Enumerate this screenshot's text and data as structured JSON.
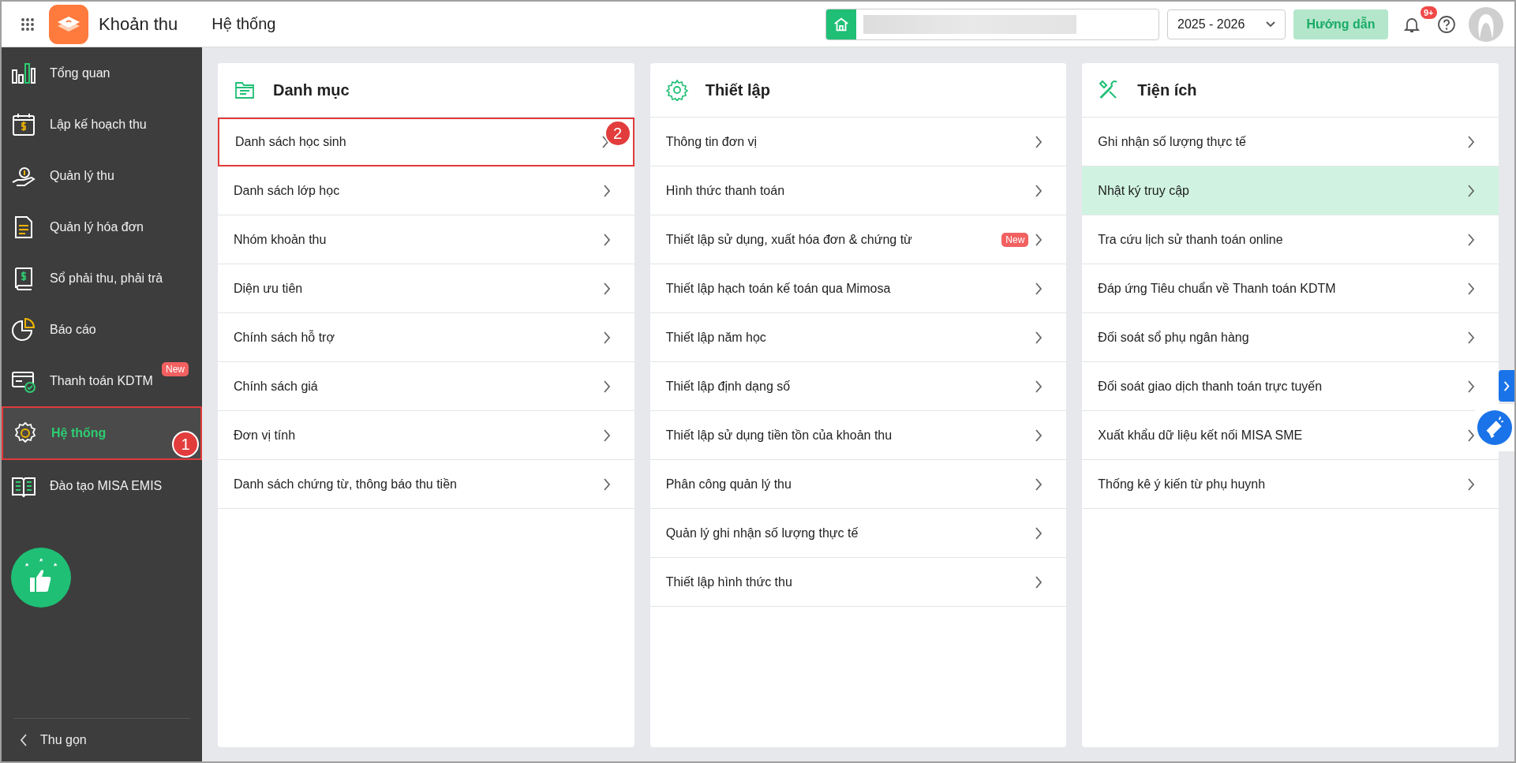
{
  "header": {
    "app_name": "Khoản thu",
    "page_title": "Hệ thống",
    "year_select": {
      "value": "2025 - 2026"
    },
    "guide_button": "Hướng dẫn",
    "notification_badge": "9+"
  },
  "sidebar": {
    "items": [
      {
        "label": "Tổng quan",
        "selected": false
      },
      {
        "label": "Lập kế hoạch thu",
        "selected": false
      },
      {
        "label": "Quản lý thu",
        "selected": false
      },
      {
        "label": "Quản lý hóa đơn",
        "selected": false
      },
      {
        "label": "Sổ phải thu, phải trả",
        "selected": false
      },
      {
        "label": "Báo cáo",
        "selected": false
      },
      {
        "label": "Thanh toán KDTM",
        "selected": false,
        "badge": "New"
      },
      {
        "label": "Hệ thống",
        "selected": true,
        "callout": "1"
      },
      {
        "label": "Đào tạo MISA EMIS",
        "selected": false
      }
    ],
    "collapse": "Thu gọn"
  },
  "cards": [
    {
      "title": "Danh mục",
      "rows": [
        {
          "label": "Danh sách học sinh",
          "highlighted": false,
          "callout": "2"
        },
        {
          "label": "Danh sách lớp học",
          "highlighted": false
        },
        {
          "label": "Nhóm khoản thu",
          "highlighted": false
        },
        {
          "label": "Diện ưu tiên",
          "highlighted": false
        },
        {
          "label": "Chính sách hỗ trợ",
          "highlighted": false
        },
        {
          "label": "Chính sách giá",
          "highlighted": false
        },
        {
          "label": "Đơn vị tính",
          "highlighted": false
        },
        {
          "label": "Danh sách chứng từ, thông báo thu tiền",
          "highlighted": false
        }
      ]
    },
    {
      "title": "Thiết lập",
      "rows": [
        {
          "label": "Thông tin đơn vị",
          "highlighted": false
        },
        {
          "label": "Hình thức thanh toán",
          "highlighted": false
        },
        {
          "label": "Thiết lập sử dụng, xuất hóa đơn & chứng từ",
          "highlighted": false,
          "badge": "New"
        },
        {
          "label": "Thiết lập hạch toán kế toán qua Mimosa",
          "highlighted": false
        },
        {
          "label": "Thiết lập năm học",
          "highlighted": false
        },
        {
          "label": "Thiết lập định dạng số",
          "highlighted": false
        },
        {
          "label": "Thiết lập sử dụng tiền tồn của khoản thu",
          "highlighted": false
        },
        {
          "label": "Phân công quản lý thu",
          "highlighted": false
        },
        {
          "label": "Quản lý ghi nhận số lượng thực tế",
          "highlighted": false
        },
        {
          "label": "Thiết lập hình thức thu",
          "highlighted": false
        }
      ]
    },
    {
      "title": "Tiện ích",
      "rows": [
        {
          "label": "Ghi nhận số lượng thực tế",
          "highlighted": false
        },
        {
          "label": "Nhật ký truy cập",
          "highlighted": true
        },
        {
          "label": "Tra cứu lịch sử thanh toán online",
          "highlighted": false
        },
        {
          "label": "Đáp ứng Tiêu chuẩn về Thanh toán KDTM",
          "highlighted": false
        },
        {
          "label": "Đối soát sổ phụ ngân hàng",
          "highlighted": false
        },
        {
          "label": "Đối soát giao dịch thanh toán trực tuyến",
          "highlighted": false
        },
        {
          "label": "Xuất khẩu dữ liệu kết nối MISA SME",
          "highlighted": false
        },
        {
          "label": "Thống kê ý kiến từ phụ huynh",
          "highlighted": false
        }
      ]
    }
  ]
}
